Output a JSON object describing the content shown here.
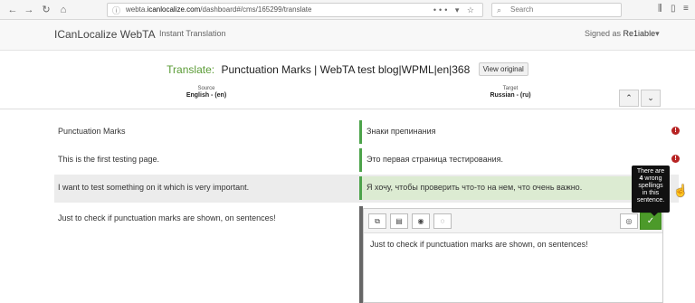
{
  "browser": {
    "url_prefix": "webta.",
    "url_domain": "icanlocalize.com",
    "url_path": "/dashboard#/cms/165299/translate",
    "search_placeholder": "Search",
    "icons": [
      "back-icon",
      "forward-icon",
      "reload-icon",
      "home-icon",
      "info-icon",
      "more-icon",
      "pocket-icon",
      "star-icon",
      "search-icon",
      "library-icon",
      "sidebar-icon",
      "menu-icon"
    ]
  },
  "app": {
    "brand": "ICanLocalize WebTA",
    "nav": "Instant Translation",
    "signed_prefix": "Signed as",
    "user": "Re1iable"
  },
  "translate": {
    "label": "Translate:",
    "title": "Punctuation Marks | WebTA test blog|WPML|en|368",
    "view_original": "View original"
  },
  "languages": {
    "source_caption": "Source",
    "source_value": "English - (en)",
    "target_caption": "Target",
    "target_value": "Russian - (ru)"
  },
  "rows": [
    {
      "source": "Punctuation Marks",
      "target": "Знаки препинания"
    },
    {
      "source": "This is the first testing page.",
      "target": "Это первая страница тестирования."
    },
    {
      "source": "I want to test something on it which is very important.",
      "target": "Я хочу, чтобы проверить что-то на нем, что очень важно."
    }
  ],
  "editor": {
    "source": "Just to check if punctuation marks are shown, on sentences!",
    "text": "Just to check if punctuation marks are shown, on sentences!"
  },
  "tooltip": {
    "line1": "There are",
    "count": "4",
    "line2": "wrong",
    "line3": "spellings",
    "line4": "in this",
    "line5": "sentence."
  },
  "colors": {
    "accent_green": "#5a9b35",
    "target_bar": "#4ca34a",
    "warning_red": "#b72323"
  }
}
